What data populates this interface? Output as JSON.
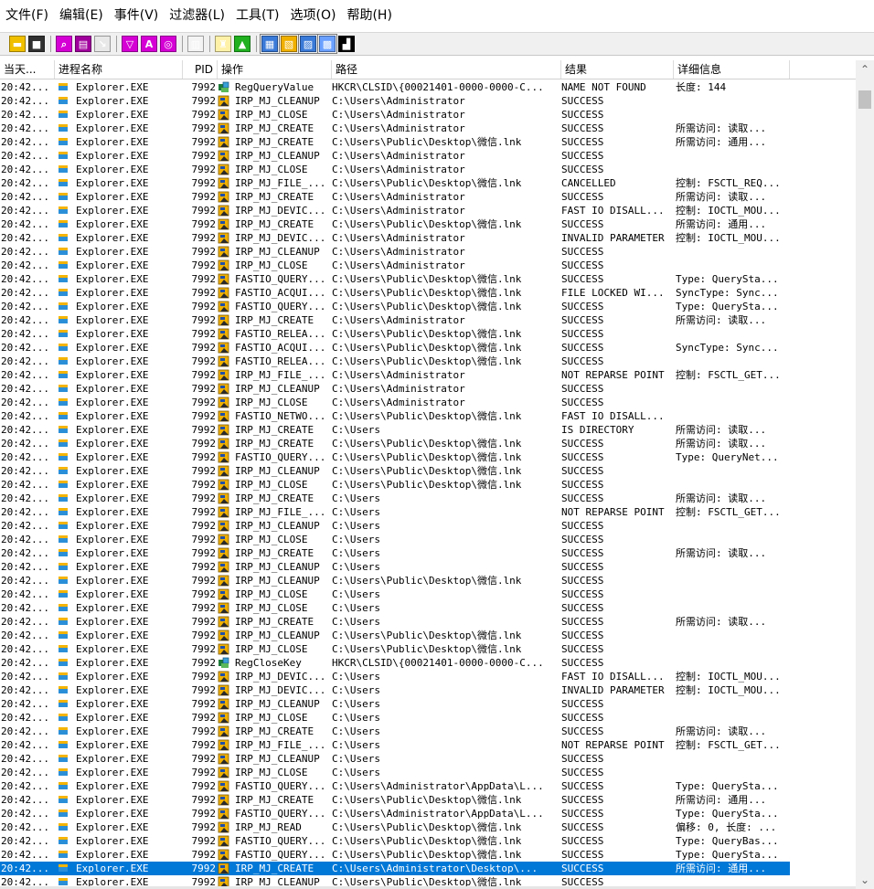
{
  "menu": [
    "文件(F)",
    "编辑(E)",
    "事件(V)",
    "过滤器(L)",
    "工具(T)",
    "选项(O)",
    "帮助(H)"
  ],
  "toolbar": [
    {
      "icon": "open-folder-icon",
      "color": "#f0c000",
      "glyph": "▬"
    },
    {
      "icon": "save-icon",
      "color": "#303030",
      "glyph": "■"
    },
    {
      "sep": true
    },
    {
      "icon": "magnifier-icon",
      "color": "#d400d4",
      "glyph": "⌕"
    },
    {
      "icon": "capture-icon",
      "color": "#a0009c",
      "glyph": "▤"
    },
    {
      "icon": "autoscroll-icon",
      "color": "#e8e8e8",
      "glyph": "↘"
    },
    {
      "sep": true
    },
    {
      "icon": "filter-icon",
      "color": "#d400d4",
      "glyph": "▽"
    },
    {
      "icon": "highlight-icon",
      "color": "#d400d4",
      "glyph": "A"
    },
    {
      "icon": "target-icon",
      "color": "#d400d4",
      "glyph": "◎"
    },
    {
      "sep": true
    },
    {
      "icon": "process-tree-icon",
      "color": "#f4f4f4",
      "glyph": "▥"
    },
    {
      "sep": true
    },
    {
      "icon": "binoculars-icon",
      "color": "#fff2a8",
      "glyph": "♜"
    },
    {
      "icon": "jump-icon",
      "color": "#20b020",
      "glyph": "▲"
    },
    {
      "sep": true
    },
    {
      "icon": "registry-activity-icon",
      "color": "#3a7ad8",
      "glyph": "▦",
      "pressed": true
    },
    {
      "icon": "file-activity-icon",
      "color": "#f0b000",
      "glyph": "▧",
      "pressed": true
    },
    {
      "icon": "network-activity-icon",
      "color": "#3a7ad8",
      "glyph": "▨",
      "pressed": true
    },
    {
      "icon": "process-activity-icon",
      "color": "#6aa0ff",
      "glyph": "▩",
      "pressed": true
    },
    {
      "icon": "profiling-icon",
      "color": "#000000",
      "glyph": "▟"
    }
  ],
  "columns": [
    "当天...",
    "进程名称",
    "PID",
    "操作",
    "路径",
    "结果",
    "详细信息"
  ],
  "colors": {
    "selected": "#0078d7",
    "file_icon": "#f0b000",
    "reg_icon": "#1e7a3a"
  },
  "rows": [
    {
      "time": "20:42...",
      "proc": "Explorer.EXE",
      "pid": "7992",
      "icon": "reg",
      "op": "RegQueryValue",
      "path": "HKCR\\CLSID\\{00021401-0000-0000-C...",
      "result": "NAME NOT FOUND",
      "detail": "长度: 144"
    },
    {
      "time": "20:42...",
      "proc": "Explorer.EXE",
      "pid": "7992",
      "icon": "file",
      "op": "IRP_MJ_CLEANUP",
      "path": "C:\\Users\\Administrator",
      "result": "SUCCESS",
      "detail": ""
    },
    {
      "time": "20:42...",
      "proc": "Explorer.EXE",
      "pid": "7992",
      "icon": "file",
      "op": "IRP_MJ_CLOSE",
      "path": "C:\\Users\\Administrator",
      "result": "SUCCESS",
      "detail": ""
    },
    {
      "time": "20:42...",
      "proc": "Explorer.EXE",
      "pid": "7992",
      "icon": "file",
      "op": "IRP_MJ_CREATE",
      "path": "C:\\Users\\Administrator",
      "result": "SUCCESS",
      "detail": "所需访问: 读取..."
    },
    {
      "time": "20:42...",
      "proc": "Explorer.EXE",
      "pid": "7992",
      "icon": "file",
      "op": "IRP_MJ_CREATE",
      "path": "C:\\Users\\Public\\Desktop\\微信.lnk",
      "result": "SUCCESS",
      "detail": "所需访问: 通用..."
    },
    {
      "time": "20:42...",
      "proc": "Explorer.EXE",
      "pid": "7992",
      "icon": "file",
      "op": "IRP_MJ_CLEANUP",
      "path": "C:\\Users\\Administrator",
      "result": "SUCCESS",
      "detail": ""
    },
    {
      "time": "20:42...",
      "proc": "Explorer.EXE",
      "pid": "7992",
      "icon": "file",
      "op": "IRP_MJ_CLOSE",
      "path": "C:\\Users\\Administrator",
      "result": "SUCCESS",
      "detail": ""
    },
    {
      "time": "20:42...",
      "proc": "Explorer.EXE",
      "pid": "7992",
      "icon": "file",
      "op": "IRP_MJ_FILE_...",
      "path": "C:\\Users\\Public\\Desktop\\微信.lnk",
      "result": "CANCELLED",
      "detail": "控制: FSCTL_REQ..."
    },
    {
      "time": "20:42...",
      "proc": "Explorer.EXE",
      "pid": "7992",
      "icon": "file",
      "op": "IRP_MJ_CREATE",
      "path": "C:\\Users\\Administrator",
      "result": "SUCCESS",
      "detail": "所需访问: 读取..."
    },
    {
      "time": "20:42...",
      "proc": "Explorer.EXE",
      "pid": "7992",
      "icon": "file",
      "op": "IRP_MJ_DEVIC...",
      "path": "C:\\Users\\Administrator",
      "result": "FAST IO DISALL...",
      "detail": "控制: IOCTL_MOU..."
    },
    {
      "time": "20:42...",
      "proc": "Explorer.EXE",
      "pid": "7992",
      "icon": "file",
      "op": "IRP_MJ_CREATE",
      "path": "C:\\Users\\Public\\Desktop\\微信.lnk",
      "result": "SUCCESS",
      "detail": "所需访问: 通用..."
    },
    {
      "time": "20:42...",
      "proc": "Explorer.EXE",
      "pid": "7992",
      "icon": "file",
      "op": "IRP_MJ_DEVIC...",
      "path": "C:\\Users\\Administrator",
      "result": "INVALID PARAMETER",
      "detail": "控制: IOCTL_MOU..."
    },
    {
      "time": "20:42...",
      "proc": "Explorer.EXE",
      "pid": "7992",
      "icon": "file",
      "op": "IRP_MJ_CLEANUP",
      "path": "C:\\Users\\Administrator",
      "result": "SUCCESS",
      "detail": ""
    },
    {
      "time": "20:42...",
      "proc": "Explorer.EXE",
      "pid": "7992",
      "icon": "file",
      "op": "IRP_MJ_CLOSE",
      "path": "C:\\Users\\Administrator",
      "result": "SUCCESS",
      "detail": ""
    },
    {
      "time": "20:42...",
      "proc": "Explorer.EXE",
      "pid": "7992",
      "icon": "file",
      "op": "FASTIO_QUERY...",
      "path": "C:\\Users\\Public\\Desktop\\微信.lnk",
      "result": "SUCCESS",
      "detail": "Type: QuerySta..."
    },
    {
      "time": "20:42...",
      "proc": "Explorer.EXE",
      "pid": "7992",
      "icon": "file",
      "op": "FASTIO_ACQUI...",
      "path": "C:\\Users\\Public\\Desktop\\微信.lnk",
      "result": "FILE LOCKED WI...",
      "detail": "SyncType: Sync..."
    },
    {
      "time": "20:42...",
      "proc": "Explorer.EXE",
      "pid": "7992",
      "icon": "file",
      "op": "FASTIO_QUERY...",
      "path": "C:\\Users\\Public\\Desktop\\微信.lnk",
      "result": "SUCCESS",
      "detail": "Type: QuerySta..."
    },
    {
      "time": "20:42...",
      "proc": "Explorer.EXE",
      "pid": "7992",
      "icon": "file",
      "op": "IRP_MJ_CREATE",
      "path": "C:\\Users\\Administrator",
      "result": "SUCCESS",
      "detail": "所需访问: 读取..."
    },
    {
      "time": "20:42...",
      "proc": "Explorer.EXE",
      "pid": "7992",
      "icon": "file",
      "op": "FASTIO_RELEA...",
      "path": "C:\\Users\\Public\\Desktop\\微信.lnk",
      "result": "SUCCESS",
      "detail": ""
    },
    {
      "time": "20:42...",
      "proc": "Explorer.EXE",
      "pid": "7992",
      "icon": "file",
      "op": "FASTIO_ACQUI...",
      "path": "C:\\Users\\Public\\Desktop\\微信.lnk",
      "result": "SUCCESS",
      "detail": "SyncType: Sync..."
    },
    {
      "time": "20:42...",
      "proc": "Explorer.EXE",
      "pid": "7992",
      "icon": "file",
      "op": "FASTIO_RELEA...",
      "path": "C:\\Users\\Public\\Desktop\\微信.lnk",
      "result": "SUCCESS",
      "detail": ""
    },
    {
      "time": "20:42...",
      "proc": "Explorer.EXE",
      "pid": "7992",
      "icon": "file",
      "op": "IRP_MJ_FILE_...",
      "path": "C:\\Users\\Administrator",
      "result": "NOT REPARSE POINT",
      "detail": "控制: FSCTL_GET..."
    },
    {
      "time": "20:42...",
      "proc": "Explorer.EXE",
      "pid": "7992",
      "icon": "file",
      "op": "IRP_MJ_CLEANUP",
      "path": "C:\\Users\\Administrator",
      "result": "SUCCESS",
      "detail": ""
    },
    {
      "time": "20:42...",
      "proc": "Explorer.EXE",
      "pid": "7992",
      "icon": "file",
      "op": "IRP_MJ_CLOSE",
      "path": "C:\\Users\\Administrator",
      "result": "SUCCESS",
      "detail": ""
    },
    {
      "time": "20:42...",
      "proc": "Explorer.EXE",
      "pid": "7992",
      "icon": "file",
      "op": "FASTIO_NETWO...",
      "path": "C:\\Users\\Public\\Desktop\\微信.lnk",
      "result": "FAST IO DISALL...",
      "detail": ""
    },
    {
      "time": "20:42...",
      "proc": "Explorer.EXE",
      "pid": "7992",
      "icon": "file",
      "op": "IRP_MJ_CREATE",
      "path": "C:\\Users",
      "result": "IS DIRECTORY",
      "detail": "所需访问: 读取..."
    },
    {
      "time": "20:42...",
      "proc": "Explorer.EXE",
      "pid": "7992",
      "icon": "file",
      "op": "IRP_MJ_CREATE",
      "path": "C:\\Users\\Public\\Desktop\\微信.lnk",
      "result": "SUCCESS",
      "detail": "所需访问: 读取..."
    },
    {
      "time": "20:42...",
      "proc": "Explorer.EXE",
      "pid": "7992",
      "icon": "file",
      "op": "FASTIO_QUERY...",
      "path": "C:\\Users\\Public\\Desktop\\微信.lnk",
      "result": "SUCCESS",
      "detail": "Type: QueryNet..."
    },
    {
      "time": "20:42...",
      "proc": "Explorer.EXE",
      "pid": "7992",
      "icon": "file",
      "op": "IRP_MJ_CLEANUP",
      "path": "C:\\Users\\Public\\Desktop\\微信.lnk",
      "result": "SUCCESS",
      "detail": ""
    },
    {
      "time": "20:42...",
      "proc": "Explorer.EXE",
      "pid": "7992",
      "icon": "file",
      "op": "IRP_MJ_CLOSE",
      "path": "C:\\Users\\Public\\Desktop\\微信.lnk",
      "result": "SUCCESS",
      "detail": ""
    },
    {
      "time": "20:42...",
      "proc": "Explorer.EXE",
      "pid": "7992",
      "icon": "file",
      "op": "IRP_MJ_CREATE",
      "path": "C:\\Users",
      "result": "SUCCESS",
      "detail": "所需访问: 读取..."
    },
    {
      "time": "20:42...",
      "proc": "Explorer.EXE",
      "pid": "7992",
      "icon": "file",
      "op": "IRP_MJ_FILE_...",
      "path": "C:\\Users",
      "result": "NOT REPARSE POINT",
      "detail": "控制: FSCTL_GET..."
    },
    {
      "time": "20:42...",
      "proc": "Explorer.EXE",
      "pid": "7992",
      "icon": "file",
      "op": "IRP_MJ_CLEANUP",
      "path": "C:\\Users",
      "result": "SUCCESS",
      "detail": ""
    },
    {
      "time": "20:42...",
      "proc": "Explorer.EXE",
      "pid": "7992",
      "icon": "file",
      "op": "IRP_MJ_CLOSE",
      "path": "C:\\Users",
      "result": "SUCCESS",
      "detail": ""
    },
    {
      "time": "20:42...",
      "proc": "Explorer.EXE",
      "pid": "7992",
      "icon": "file",
      "op": "IRP_MJ_CREATE",
      "path": "C:\\Users",
      "result": "SUCCESS",
      "detail": "所需访问: 读取..."
    },
    {
      "time": "20:42...",
      "proc": "Explorer.EXE",
      "pid": "7992",
      "icon": "file",
      "op": "IRP_MJ_CLEANUP",
      "path": "C:\\Users",
      "result": "SUCCESS",
      "detail": ""
    },
    {
      "time": "20:42...",
      "proc": "Explorer.EXE",
      "pid": "7992",
      "icon": "file",
      "op": "IRP_MJ_CLEANUP",
      "path": "C:\\Users\\Public\\Desktop\\微信.lnk",
      "result": "SUCCESS",
      "detail": ""
    },
    {
      "time": "20:42...",
      "proc": "Explorer.EXE",
      "pid": "7992",
      "icon": "file",
      "op": "IRP_MJ_CLOSE",
      "path": "C:\\Users",
      "result": "SUCCESS",
      "detail": ""
    },
    {
      "time": "20:42...",
      "proc": "Explorer.EXE",
      "pid": "7992",
      "icon": "file",
      "op": "IRP_MJ_CLOSE",
      "path": "C:\\Users",
      "result": "SUCCESS",
      "detail": ""
    },
    {
      "time": "20:42...",
      "proc": "Explorer.EXE",
      "pid": "7992",
      "icon": "file",
      "op": "IRP_MJ_CREATE",
      "path": "C:\\Users",
      "result": "SUCCESS",
      "detail": "所需访问: 读取..."
    },
    {
      "time": "20:42...",
      "proc": "Explorer.EXE",
      "pid": "7992",
      "icon": "file",
      "op": "IRP_MJ_CLEANUP",
      "path": "C:\\Users\\Public\\Desktop\\微信.lnk",
      "result": "SUCCESS",
      "detail": ""
    },
    {
      "time": "20:42...",
      "proc": "Explorer.EXE",
      "pid": "7992",
      "icon": "file",
      "op": "IRP_MJ_CLOSE",
      "path": "C:\\Users\\Public\\Desktop\\微信.lnk",
      "result": "SUCCESS",
      "detail": ""
    },
    {
      "time": "20:42...",
      "proc": "Explorer.EXE",
      "pid": "7992",
      "icon": "reg",
      "op": "RegCloseKey",
      "path": "HKCR\\CLSID\\{00021401-0000-0000-C...",
      "result": "SUCCESS",
      "detail": ""
    },
    {
      "time": "20:42...",
      "proc": "Explorer.EXE",
      "pid": "7992",
      "icon": "file",
      "op": "IRP_MJ_DEVIC...",
      "path": "C:\\Users",
      "result": "FAST IO DISALL...",
      "detail": "控制: IOCTL_MOU..."
    },
    {
      "time": "20:42...",
      "proc": "Explorer.EXE",
      "pid": "7992",
      "icon": "file",
      "op": "IRP_MJ_DEVIC...",
      "path": "C:\\Users",
      "result": "INVALID PARAMETER",
      "detail": "控制: IOCTL_MOU..."
    },
    {
      "time": "20:42...",
      "proc": "Explorer.EXE",
      "pid": "7992",
      "icon": "file",
      "op": "IRP_MJ_CLEANUP",
      "path": "C:\\Users",
      "result": "SUCCESS",
      "detail": ""
    },
    {
      "time": "20:42...",
      "proc": "Explorer.EXE",
      "pid": "7992",
      "icon": "file",
      "op": "IRP_MJ_CLOSE",
      "path": "C:\\Users",
      "result": "SUCCESS",
      "detail": ""
    },
    {
      "time": "20:42...",
      "proc": "Explorer.EXE",
      "pid": "7992",
      "icon": "file",
      "op": "IRP_MJ_CREATE",
      "path": "C:\\Users",
      "result": "SUCCESS",
      "detail": "所需访问: 读取..."
    },
    {
      "time": "20:42...",
      "proc": "Explorer.EXE",
      "pid": "7992",
      "icon": "file",
      "op": "IRP_MJ_FILE_...",
      "path": "C:\\Users",
      "result": "NOT REPARSE POINT",
      "detail": "控制: FSCTL_GET..."
    },
    {
      "time": "20:42...",
      "proc": "Explorer.EXE",
      "pid": "7992",
      "icon": "file",
      "op": "IRP_MJ_CLEANUP",
      "path": "C:\\Users",
      "result": "SUCCESS",
      "detail": ""
    },
    {
      "time": "20:42...",
      "proc": "Explorer.EXE",
      "pid": "7992",
      "icon": "file",
      "op": "IRP_MJ_CLOSE",
      "path": "C:\\Users",
      "result": "SUCCESS",
      "detail": ""
    },
    {
      "time": "20:42...",
      "proc": "Explorer.EXE",
      "pid": "7992",
      "icon": "file",
      "op": "FASTIO_QUERY...",
      "path": "C:\\Users\\Administrator\\AppData\\L...",
      "result": "SUCCESS",
      "detail": "Type: QuerySta..."
    },
    {
      "time": "20:42...",
      "proc": "Explorer.EXE",
      "pid": "7992",
      "icon": "file",
      "op": "IRP_MJ_CREATE",
      "path": "C:\\Users\\Public\\Desktop\\微信.lnk",
      "result": "SUCCESS",
      "detail": "所需访问: 通用..."
    },
    {
      "time": "20:42...",
      "proc": "Explorer.EXE",
      "pid": "7992",
      "icon": "file",
      "op": "FASTIO_QUERY...",
      "path": "C:\\Users\\Administrator\\AppData\\L...",
      "result": "SUCCESS",
      "detail": "Type: QuerySta..."
    },
    {
      "time": "20:42...",
      "proc": "Explorer.EXE",
      "pid": "7992",
      "icon": "file",
      "op": "IRP_MJ_READ",
      "path": "C:\\Users\\Public\\Desktop\\微信.lnk",
      "result": "SUCCESS",
      "detail": "偏移: 0, 长度: ..."
    },
    {
      "time": "20:42...",
      "proc": "Explorer.EXE",
      "pid": "7992",
      "icon": "file",
      "op": "FASTIO_QUERY...",
      "path": "C:\\Users\\Public\\Desktop\\微信.lnk",
      "result": "SUCCESS",
      "detail": "Type: QueryBas..."
    },
    {
      "time": "20:42...",
      "proc": "Explorer.EXE",
      "pid": "7992",
      "icon": "file",
      "op": "FASTIO_QUERY...",
      "path": "C:\\Users\\Public\\Desktop\\微信.lnk",
      "result": "SUCCESS",
      "detail": "Type: QuerySta..."
    },
    {
      "time": "20:42...",
      "proc": "Explorer.EXE",
      "pid": "7992",
      "icon": "file",
      "op": "IRP_MJ_CREATE",
      "path": "C:\\Users\\Administrator\\Desktop\\...",
      "result": "SUCCESS",
      "detail": "所需访问: 通用...",
      "selected": true
    },
    {
      "time": "20:42...",
      "proc": "Explorer.EXE",
      "pid": "7992",
      "icon": "file",
      "op": "IRP_MJ_CLEANUP",
      "path": "C:\\Users\\Public\\Desktop\\微信.lnk",
      "result": "SUCCESS",
      "detail": ""
    }
  ]
}
